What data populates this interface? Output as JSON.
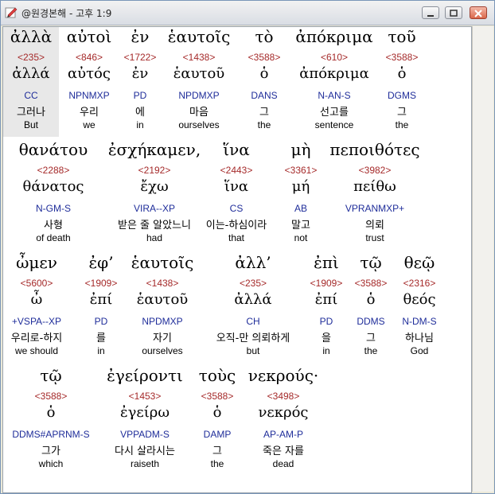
{
  "window": {
    "title": "@원경본해 - 고후 1:9",
    "icon": "pencil-edit-icon"
  },
  "rows": [
    {
      "cells": [
        {
          "greek": "ἀλλὰ",
          "strong": "<235>",
          "lemma": "ἀλλά",
          "parse": "CC",
          "korean": "그러나",
          "english": "But",
          "highlight": true
        },
        {
          "greek": "αὐτοὶ",
          "strong": "<846>",
          "lemma": "αὐτός",
          "parse": "NPNMXP",
          "korean": "우리",
          "english": "we"
        },
        {
          "greek": "ἐν",
          "strong": "<1722>",
          "lemma": "ἐν",
          "parse": "PD",
          "korean": "에",
          "english": "in"
        },
        {
          "greek": "ἑαυτοῖς",
          "strong": "<1438>",
          "lemma": "ἑαυτοῦ",
          "parse": "NPDMXP",
          "korean": "마음",
          "english": "ourselves"
        },
        {
          "greek": "τὸ",
          "strong": "<3588>",
          "lemma": "ὁ",
          "parse": "DANS",
          "korean": "그",
          "english": "the"
        },
        {
          "greek": "ἀπόκριμα",
          "strong": "<610>",
          "lemma": "ἀπόκριμα",
          "parse": "N-AN-S",
          "korean": "선고를",
          "english": "sentence"
        },
        {
          "greek": "τοῦ",
          "strong": "<3588>",
          "lemma": "ὁ",
          "parse": "DGMS",
          "korean": "그",
          "english": "the"
        }
      ]
    },
    {
      "cells": [
        {
          "greek": "θανάτου",
          "strong": "<2288>",
          "lemma": "θάνατος",
          "parse": "N-GM-S",
          "korean": "사형",
          "english": "of death"
        },
        {
          "greek": "ἐσχήκαμεν,",
          "strong": "<2192>",
          "lemma": "ἔχω",
          "parse": "VIRA--XP",
          "korean": "받은 줄 알았느니",
          "english": "had"
        },
        {
          "greek": "ἵνα",
          "strong": "<2443>",
          "lemma": "ἵνα",
          "parse": "CS",
          "korean": "이는-하심이라",
          "english": "that"
        },
        {
          "greek": "μὴ",
          "strong": "<3361>",
          "lemma": "μή",
          "parse": "AB",
          "korean": "말고",
          "english": "not"
        },
        {
          "greek": "πεποιθότες",
          "strong": "<3982>",
          "lemma": "πείθω",
          "parse": "VPRANMXP+",
          "korean": "의뢰",
          "english": "trust"
        }
      ]
    },
    {
      "cells": [
        {
          "greek": "ὦμεν",
          "strong": "<5600>",
          "lemma": "ὦ",
          "parse": "+VSPA--XP",
          "korean": "우리로-하지",
          "english": "we should"
        },
        {
          "greek": "ἐφ’",
          "strong": "<1909>",
          "lemma": "ἐπί",
          "parse": "PD",
          "korean": "를",
          "english": "in"
        },
        {
          "greek": "ἑαυτοῖς",
          "strong": "<1438>",
          "lemma": "ἑαυτοῦ",
          "parse": "NPDMXP",
          "korean": "자기",
          "english": "ourselves"
        },
        {
          "greek": "ἀλλ’",
          "strong": "<235>",
          "lemma": "ἀλλά",
          "parse": "CH",
          "korean": "오직-만 의뢰하게",
          "english": "but"
        },
        {
          "greek": "ἐπὶ",
          "strong": "<1909>",
          "lemma": "ἐπί",
          "parse": "PD",
          "korean": "을",
          "english": "in"
        },
        {
          "greek": "τῷ",
          "strong": "<3588>",
          "lemma": "ὁ",
          "parse": "DDMS",
          "korean": "그",
          "english": "the"
        },
        {
          "greek": "θεῷ",
          "strong": "<2316>",
          "lemma": "θεός",
          "parse": "N-DM-S",
          "korean": "하나님",
          "english": "God"
        }
      ]
    },
    {
      "cells": [
        {
          "greek": "τῷ",
          "strong": "<3588>",
          "lemma": "ὁ",
          "parse": "DDMS#APRNM-S",
          "korean": "그가",
          "english": "which"
        },
        {
          "greek": "ἐγείροντι",
          "strong": "<1453>",
          "lemma": "ἐγείρω",
          "parse": "VPPADM-S",
          "korean": "다시 살라시는",
          "english": "raiseth"
        },
        {
          "greek": "τοὺς",
          "strong": "<3588>",
          "lemma": "ὁ",
          "parse": "DAMP",
          "korean": "그",
          "english": "the"
        },
        {
          "greek": "νεκρούς·",
          "strong": "<3498>",
          "lemma": "νεκρός",
          "parse": "AP-AM-P",
          "korean": "죽은 자를",
          "english": "dead"
        }
      ]
    }
  ]
}
